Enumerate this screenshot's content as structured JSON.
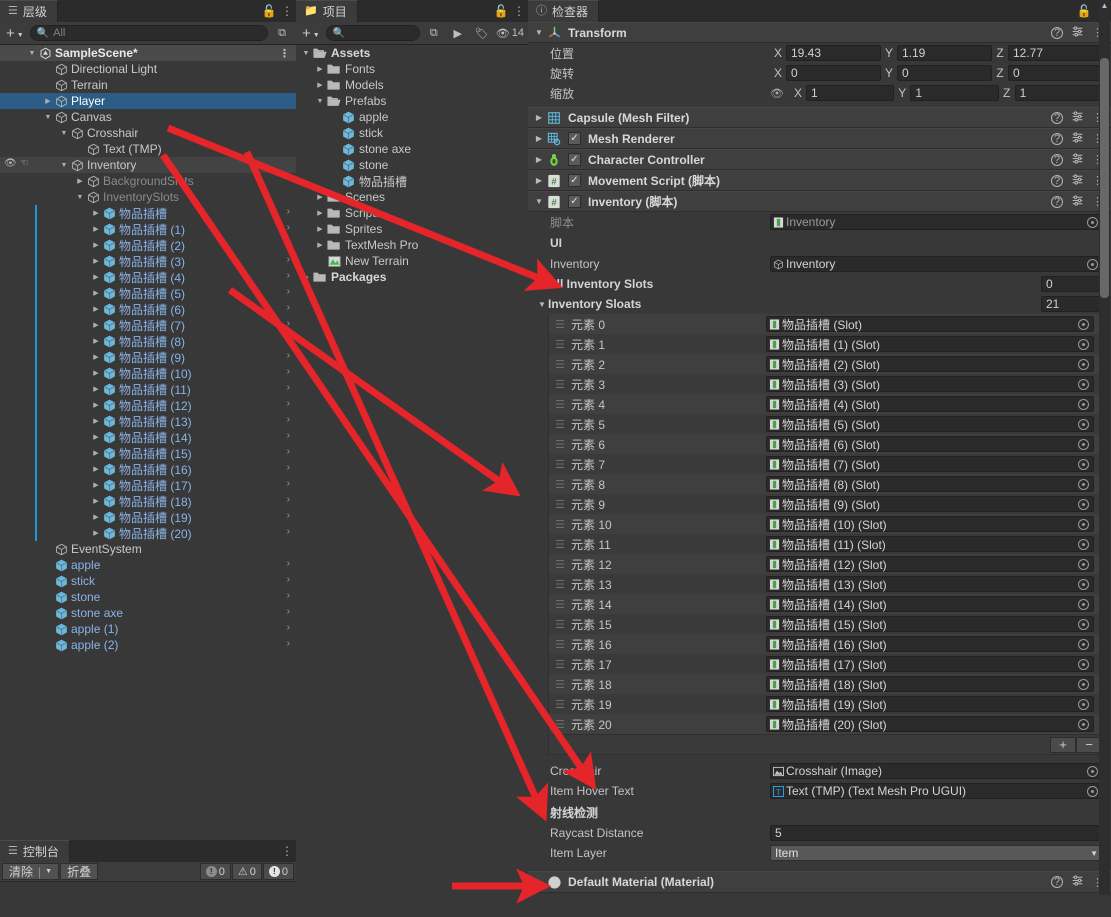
{
  "hierarchy": {
    "tab_label": "层级",
    "tab_icon": "hierarchy-icon",
    "search_placeholder": "All",
    "add_label": "+",
    "items": [
      {
        "label": "SampleScene*",
        "depth": 1,
        "type": "scene",
        "twisty": "down",
        "state": "scene"
      },
      {
        "label": "Directional Light",
        "depth": 2,
        "type": "go",
        "twisty": "",
        "state": ""
      },
      {
        "label": "Terrain",
        "depth": 2,
        "type": "go",
        "twisty": "",
        "state": ""
      },
      {
        "label": "Player",
        "depth": 2,
        "type": "go",
        "twisty": "right",
        "state": "selected"
      },
      {
        "label": "Canvas",
        "depth": 2,
        "type": "go",
        "twisty": "down",
        "state": ""
      },
      {
        "label": "Crosshair",
        "depth": 3,
        "type": "go",
        "twisty": "down",
        "state": ""
      },
      {
        "label": "Text (TMP)",
        "depth": 4,
        "type": "go",
        "twisty": "",
        "state": ""
      },
      {
        "label": "Inventory",
        "depth": 3,
        "type": "go",
        "twisty": "down",
        "state": "hovered",
        "vis": true
      },
      {
        "label": "BackgroundSlots",
        "depth": 4,
        "type": "go",
        "twisty": "right",
        "state": "dim"
      },
      {
        "label": "InventorySlots",
        "depth": 4,
        "type": "go",
        "twisty": "down",
        "state": "dim"
      },
      {
        "label": "物品插槽",
        "depth": 5,
        "type": "prefab",
        "twisty": "right",
        "state": "prefab",
        "mark": true
      },
      {
        "label": "物品插槽 (1)",
        "depth": 5,
        "type": "prefab",
        "twisty": "right",
        "state": "prefab",
        "mark": true
      },
      {
        "label": "物品插槽 (2)",
        "depth": 5,
        "type": "prefab",
        "twisty": "right",
        "state": "prefab",
        "mark": true
      },
      {
        "label": "物品插槽 (3)",
        "depth": 5,
        "type": "prefab",
        "twisty": "right",
        "state": "prefab",
        "mark": true
      },
      {
        "label": "物品插槽 (4)",
        "depth": 5,
        "type": "prefab",
        "twisty": "right",
        "state": "prefab",
        "mark": true
      },
      {
        "label": "物品插槽 (5)",
        "depth": 5,
        "type": "prefab",
        "twisty": "right",
        "state": "prefab",
        "mark": true
      },
      {
        "label": "物品插槽 (6)",
        "depth": 5,
        "type": "prefab",
        "twisty": "right",
        "state": "prefab",
        "mark": true
      },
      {
        "label": "物品插槽 (7)",
        "depth": 5,
        "type": "prefab",
        "twisty": "right",
        "state": "prefab",
        "mark": true
      },
      {
        "label": "物品插槽 (8)",
        "depth": 5,
        "type": "prefab",
        "twisty": "right",
        "state": "prefab",
        "mark": true
      },
      {
        "label": "物品插槽 (9)",
        "depth": 5,
        "type": "prefab",
        "twisty": "right",
        "state": "prefab",
        "mark": true
      },
      {
        "label": "物品插槽 (10)",
        "depth": 5,
        "type": "prefab",
        "twisty": "right",
        "state": "prefab",
        "mark": true
      },
      {
        "label": "物品插槽 (11)",
        "depth": 5,
        "type": "prefab",
        "twisty": "right",
        "state": "prefab",
        "mark": true
      },
      {
        "label": "物品插槽 (12)",
        "depth": 5,
        "type": "prefab",
        "twisty": "right",
        "state": "prefab",
        "mark": true
      },
      {
        "label": "物品插槽 (13)",
        "depth": 5,
        "type": "prefab",
        "twisty": "right",
        "state": "prefab",
        "mark": true
      },
      {
        "label": "物品插槽 (14)",
        "depth": 5,
        "type": "prefab",
        "twisty": "right",
        "state": "prefab",
        "mark": true
      },
      {
        "label": "物品插槽 (15)",
        "depth": 5,
        "type": "prefab",
        "twisty": "right",
        "state": "prefab",
        "mark": true
      },
      {
        "label": "物品插槽 (16)",
        "depth": 5,
        "type": "prefab",
        "twisty": "right",
        "state": "prefab",
        "mark": true
      },
      {
        "label": "物品插槽 (17)",
        "depth": 5,
        "type": "prefab",
        "twisty": "right",
        "state": "prefab",
        "mark": true
      },
      {
        "label": "物品插槽 (18)",
        "depth": 5,
        "type": "prefab",
        "twisty": "right",
        "state": "prefab",
        "mark": true
      },
      {
        "label": "物品插槽 (19)",
        "depth": 5,
        "type": "prefab",
        "twisty": "right",
        "state": "prefab",
        "mark": true
      },
      {
        "label": "物品插槽 (20)",
        "depth": 5,
        "type": "prefab",
        "twisty": "right",
        "state": "prefab",
        "mark": true
      },
      {
        "label": "EventSystem",
        "depth": 2,
        "type": "go",
        "twisty": "",
        "state": ""
      },
      {
        "label": "apple",
        "depth": 2,
        "type": "prefab",
        "twisty": "",
        "state": "prefab"
      },
      {
        "label": "stick",
        "depth": 2,
        "type": "prefab",
        "twisty": "",
        "state": "prefab"
      },
      {
        "label": "stone",
        "depth": 2,
        "type": "prefab",
        "twisty": "",
        "state": "prefab"
      },
      {
        "label": "stone axe",
        "depth": 2,
        "type": "prefab",
        "twisty": "",
        "state": "prefab"
      },
      {
        "label": "apple (1)",
        "depth": 2,
        "type": "prefab",
        "twisty": "",
        "state": "prefab"
      },
      {
        "label": "apple (2)",
        "depth": 2,
        "type": "prefab",
        "twisty": "",
        "state": "prefab"
      }
    ]
  },
  "console": {
    "tab_label": "控制台",
    "clear_label": "清除",
    "collapse_label": "折叠",
    "log_count": "0",
    "warn_count": "0",
    "error_count": "0"
  },
  "project": {
    "tab_label": "项目",
    "search_placeholder": "",
    "hidden_count": "14",
    "items": [
      {
        "label": "Assets",
        "depth": 0,
        "type": "folder-open",
        "twisty": "down",
        "bold": true
      },
      {
        "label": "Fonts",
        "depth": 1,
        "type": "folder",
        "twisty": "right",
        "bold": false
      },
      {
        "label": "Models",
        "depth": 1,
        "type": "folder",
        "twisty": "right",
        "bold": false
      },
      {
        "label": "Prefabs",
        "depth": 1,
        "type": "folder-open",
        "twisty": "down",
        "bold": false
      },
      {
        "label": "apple",
        "depth": 2,
        "type": "prefab",
        "twisty": "",
        "bold": false
      },
      {
        "label": "stick",
        "depth": 2,
        "type": "prefab",
        "twisty": "",
        "bold": false
      },
      {
        "label": "stone axe",
        "depth": 2,
        "type": "prefab",
        "twisty": "",
        "bold": false
      },
      {
        "label": "stone",
        "depth": 2,
        "type": "prefab",
        "twisty": "",
        "bold": false
      },
      {
        "label": "物品插槽",
        "depth": 2,
        "type": "prefab",
        "twisty": "",
        "bold": false
      },
      {
        "label": "Scenes",
        "depth": 1,
        "type": "folder",
        "twisty": "right",
        "bold": false
      },
      {
        "label": "Scripts",
        "depth": 1,
        "type": "folder",
        "twisty": "right",
        "bold": false
      },
      {
        "label": "Sprites",
        "depth": 1,
        "type": "folder",
        "twisty": "right",
        "bold": false
      },
      {
        "label": "TextMesh Pro",
        "depth": 1,
        "type": "folder",
        "twisty": "right",
        "bold": false
      },
      {
        "label": "New Terrain",
        "depth": 1,
        "type": "terrain",
        "twisty": "",
        "bold": false
      },
      {
        "label": "Packages",
        "depth": 0,
        "type": "folder",
        "twisty": "right",
        "bold": true
      }
    ]
  },
  "inspector": {
    "tab_label": "检查器",
    "transform": {
      "title": "Transform",
      "position_label": "位置",
      "rotation_label": "旋转",
      "scale_label": "缩放",
      "axis": [
        "X",
        "Y",
        "Z"
      ],
      "position": [
        "19.43",
        "1.19",
        "12.77"
      ],
      "rotation": [
        "0",
        "0",
        "0"
      ],
      "scale": [
        "1",
        "1",
        "1"
      ]
    },
    "components": [
      {
        "title": "Capsule (Mesh Filter)",
        "icon": "mesh-filter-icon",
        "checkbox": false,
        "expanded": false
      },
      {
        "title": "Mesh Renderer",
        "icon": "mesh-renderer-icon",
        "checkbox": true,
        "expanded": false
      },
      {
        "title": "Character Controller",
        "icon": "character-controller-icon",
        "checkbox": true,
        "expanded": false
      },
      {
        "title": "Movement Script  (脚本)",
        "icon": "script-icon",
        "checkbox": true,
        "expanded": false
      },
      {
        "title": "Inventory  (脚本)",
        "icon": "script-icon",
        "checkbox": true,
        "expanded": true
      }
    ],
    "inventory": {
      "script_label": "脚本",
      "script_value": "Inventory",
      "ui_header": "UI",
      "inventory_label": "Inventory",
      "inventory_value": "Inventory",
      "all_slots_label": "All Inventory Slots",
      "all_slots_count": "0",
      "slots_label": "Inventory Sloats",
      "slots_count": "21",
      "element_prefix": "元素",
      "elements": [
        {
          "index": "元素 0",
          "value": "物品插槽 (Slot)"
        },
        {
          "index": "元素 1",
          "value": "物品插槽 (1) (Slot)"
        },
        {
          "index": "元素 2",
          "value": "物品插槽 (2) (Slot)"
        },
        {
          "index": "元素 3",
          "value": "物品插槽 (3) (Slot)"
        },
        {
          "index": "元素 4",
          "value": "物品插槽 (4) (Slot)"
        },
        {
          "index": "元素 5",
          "value": "物品插槽 (5) (Slot)"
        },
        {
          "index": "元素 6",
          "value": "物品插槽 (6) (Slot)"
        },
        {
          "index": "元素 7",
          "value": "物品插槽 (7) (Slot)"
        },
        {
          "index": "元素 8",
          "value": "物品插槽 (8) (Slot)"
        },
        {
          "index": "元素 9",
          "value": "物品插槽 (9) (Slot)"
        },
        {
          "index": "元素 10",
          "value": "物品插槽 (10) (Slot)"
        },
        {
          "index": "元素 11",
          "value": "物品插槽 (11) (Slot)"
        },
        {
          "index": "元素 12",
          "value": "物品插槽 (12) (Slot)"
        },
        {
          "index": "元素 13",
          "value": "物品插槽 (13) (Slot)"
        },
        {
          "index": "元素 14",
          "value": "物品插槽 (14) (Slot)"
        },
        {
          "index": "元素 15",
          "value": "物品插槽 (15) (Slot)"
        },
        {
          "index": "元素 16",
          "value": "物品插槽 (16) (Slot)"
        },
        {
          "index": "元素 17",
          "value": "物品插槽 (17) (Slot)"
        },
        {
          "index": "元素 18",
          "value": "物品插槽 (18) (Slot)"
        },
        {
          "index": "元素 19",
          "value": "物品插槽 (19) (Slot)"
        },
        {
          "index": "元素 20",
          "value": "物品插槽 (20) (Slot)"
        }
      ],
      "add_label": "+",
      "remove_label": "−",
      "crosshair_label": "Crosshair",
      "crosshair_value": "Crosshair (Image)",
      "hover_text_label": "Item Hover Text",
      "hover_text_value": "Text (TMP) (Text Mesh Pro UGUI)",
      "raycast_header": "射线检测",
      "raycast_distance_label": "Raycast Distance",
      "raycast_distance_value": "5",
      "item_layer_label": "Item Layer",
      "item_layer_value": "Item"
    },
    "material_footer": "Default Material (Material)"
  },
  "colors": {
    "arrow_red": "#e5252a",
    "selection_blue": "#2c5d87",
    "prefab_blue": "#8ab4e8",
    "panel_bg": "#383838",
    "header_bg": "#3f3f3f"
  }
}
